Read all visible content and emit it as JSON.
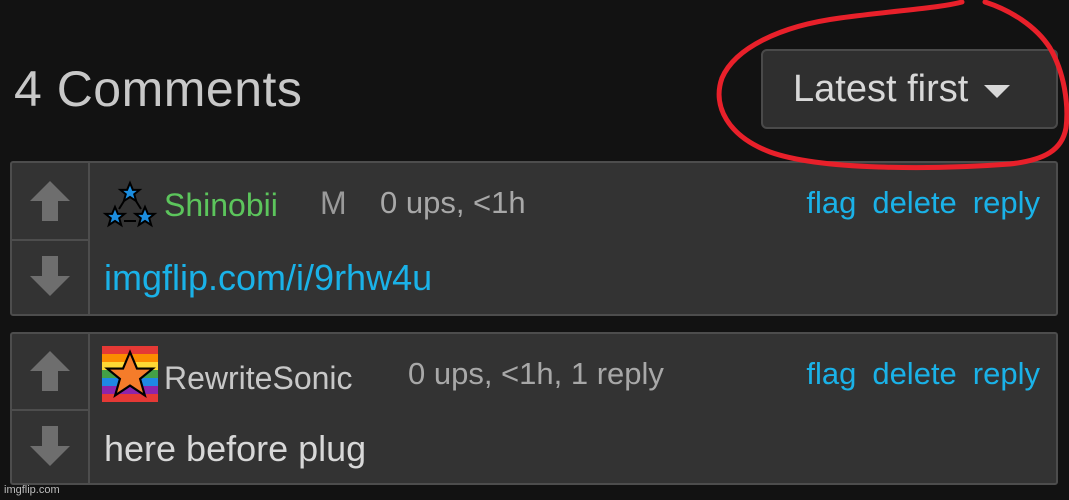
{
  "header": {
    "comments_title": "4 Comments",
    "sort": {
      "selected": "Latest first",
      "caret_icon": "caret-down-icon"
    }
  },
  "colors": {
    "background": "#121212",
    "panel": "#333333",
    "link": "#1ab2e8",
    "username_green": "#5cc55c",
    "annotation_red": "#e8202a"
  },
  "comments": [
    {
      "username": "Shinobii",
      "badge": "M",
      "meta": "0 ups, <1h",
      "actions": [
        "flag",
        "delete",
        "reply"
      ],
      "body": "imgflip.com/i/9rhw4u",
      "avatar_icon": "three-blue-stars-icon"
    },
    {
      "username": "RewriteSonic",
      "meta": "0 ups, <1h, 1 reply",
      "actions": [
        "flag",
        "delete",
        "reply"
      ],
      "body": "here before plug",
      "avatar_icon": "rainbow-orange-star-icon"
    }
  ],
  "watermark": "imgflip.com"
}
